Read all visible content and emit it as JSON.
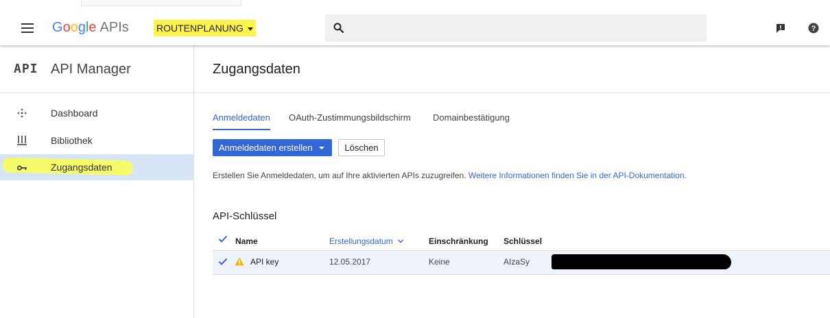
{
  "header": {
    "logo_google": [
      "G",
      "o",
      "o",
      "g",
      "l",
      "e"
    ],
    "logo_apis": "APIs",
    "project": "ROUTENPLANUNG",
    "search_placeholder": ""
  },
  "sidebar": {
    "logo_text": "API",
    "title": "API Manager",
    "items": [
      {
        "label": "Dashboard",
        "icon": "dashboard-icon"
      },
      {
        "label": "Bibliothek",
        "icon": "library-icon"
      },
      {
        "label": "Zugangsdaten",
        "icon": "key-icon",
        "active": true
      }
    ]
  },
  "main": {
    "title": "Zugangsdaten",
    "tabs": [
      {
        "label": "Anmeldedaten",
        "active": true
      },
      {
        "label": "OAuth-Zustimmungsbildschirm"
      },
      {
        "label": "Domainbestätigung"
      }
    ],
    "create_button": "Anmeldedaten erstellen",
    "delete_button": "Löschen",
    "info_text": "Erstellen Sie Anmeldedaten, um auf Ihre aktivierten APIs zuzugreifen.",
    "info_link": "Weitere Informationen finden Sie in der API-Dokumentation.",
    "section_title": "API-Schlüssel",
    "table": {
      "headers": [
        "Name",
        "Erstellungsdatum",
        "Einschränkung",
        "Schlüssel"
      ],
      "rows": [
        {
          "name": "API key",
          "date": "12.05.2017",
          "restriction": "Keine",
          "key": "AIzaSy"
        }
      ]
    }
  },
  "colors": {
    "accent": "#3367d6",
    "highlight": "#fff34c",
    "active_row": "#d6e4f6",
    "warning": "#f4b400"
  }
}
